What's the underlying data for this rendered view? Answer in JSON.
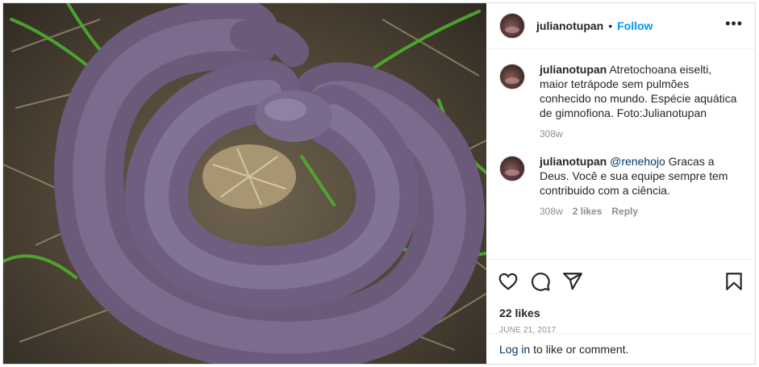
{
  "header": {
    "username": "julianotupan",
    "separator": "•",
    "follow_label": "Follow",
    "more_label": "•••"
  },
  "comments": [
    {
      "username": "julianotupan",
      "text": "Atretochoana eiselti, maior tetrápode sem pulmões conhecido no mundo. Espécie aquática de gimnofiona. Foto:Julianotupan",
      "time": "308w"
    },
    {
      "username": "julianotupan",
      "mention": "@renehojo",
      "text": "Gracas a Deus. Você e sua equipe sempre tem contribuido com a ciência.",
      "time": "308w",
      "likes": "2 likes",
      "reply_label": "Reply"
    }
  ],
  "actions": {
    "icons": [
      "heart-icon",
      "comment-icon",
      "share-icon",
      "bookmark-icon"
    ]
  },
  "likes_label": "22 likes",
  "date_label": "JUNE 21, 2017",
  "login": {
    "link_label": "Log in",
    "rest_label": "to like or comment."
  },
  "colors": {
    "follow_blue": "#0095f6",
    "link_dark_blue": "#00376b",
    "muted_gray": "#8e8e8e",
    "border": "#dbdbdb"
  }
}
